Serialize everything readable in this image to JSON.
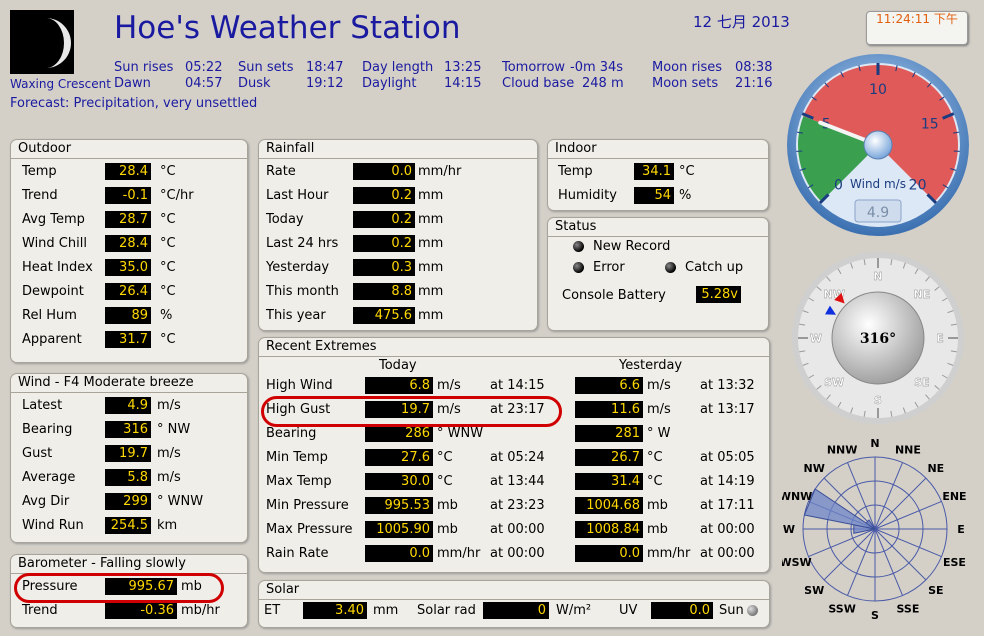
{
  "header": {
    "title": "Hoe's Weather Station",
    "date": "12 七月 2013",
    "time": "11:24:11 下午",
    "moon_phase": "Waxing Crescent",
    "forecast": "Forecast: Precipitation, very unsettled"
  },
  "sun": [
    {
      "label": "Sun rises",
      "value": "05:22"
    },
    {
      "label": "Sun sets",
      "value": "18:47"
    },
    {
      "label": "Day length",
      "value": "13:25"
    },
    {
      "label": "Tomorrow",
      "value": "-0m 34s"
    },
    {
      "label": "Moon rises",
      "value": "08:38"
    },
    {
      "label": "Dawn",
      "value": "04:57"
    },
    {
      "label": "Dusk",
      "value": "19:12"
    },
    {
      "label": "Daylight",
      "value": "14:15"
    },
    {
      "label": "Cloud base",
      "value": "248 m"
    },
    {
      "label": "Moon sets",
      "value": "21:16"
    }
  ],
  "outdoor": {
    "title": "Outdoor",
    "rows": [
      {
        "label": "Temp",
        "value": "28.4",
        "unit": "°C"
      },
      {
        "label": "Trend",
        "value": "-0.1",
        "unit": "°C/hr"
      },
      {
        "label": "Avg Temp",
        "value": "28.7",
        "unit": "°C"
      },
      {
        "label": "Wind Chill",
        "value": "28.4",
        "unit": "°C"
      },
      {
        "label": "Heat Index",
        "value": "35.0",
        "unit": "°C"
      },
      {
        "label": "Dewpoint",
        "value": "26.4",
        "unit": "°C"
      },
      {
        "label": "Rel Hum",
        "value": "89",
        "unit": "%"
      },
      {
        "label": "Apparent",
        "value": "31.7",
        "unit": "°C"
      }
    ]
  },
  "wind": {
    "title": "Wind - F4 Moderate breeze",
    "rows": [
      {
        "label": "Latest",
        "value": "4.9",
        "unit": "m/s"
      },
      {
        "label": "Bearing",
        "value": "316",
        "unit": "°  NW"
      },
      {
        "label": "Gust",
        "value": "19.7",
        "unit": "m/s"
      },
      {
        "label": "Average",
        "value": "5.8",
        "unit": "m/s"
      },
      {
        "label": "Avg Dir",
        "value": "299",
        "unit": "°  WNW"
      },
      {
        "label": "Wind Run",
        "value": "254.5",
        "unit": "km"
      }
    ]
  },
  "barometer": {
    "title": "Barometer - Falling slowly",
    "rows": [
      {
        "label": "Pressure",
        "value": "995.67",
        "unit": "mb"
      },
      {
        "label": "Trend",
        "value": "-0.36",
        "unit": "mb/hr"
      }
    ]
  },
  "rainfall": {
    "title": "Rainfall",
    "rows": [
      {
        "label": "Rate",
        "value": "0.0",
        "unit": "mm/hr"
      },
      {
        "label": "Last Hour",
        "value": "0.2",
        "unit": "mm"
      },
      {
        "label": "Today",
        "value": "0.2",
        "unit": "mm"
      },
      {
        "label": "Last 24 hrs",
        "value": "0.2",
        "unit": "mm"
      },
      {
        "label": "Yesterday",
        "value": "0.3",
        "unit": "mm"
      },
      {
        "label": "This month",
        "value": "8.8",
        "unit": "mm"
      },
      {
        "label": "This year",
        "value": "475.6",
        "unit": "mm"
      }
    ]
  },
  "indoor": {
    "title": "Indoor",
    "rows": [
      {
        "label": "Temp",
        "value": "34.1",
        "unit": "°C"
      },
      {
        "label": "Humidity",
        "value": "54",
        "unit": "%"
      }
    ]
  },
  "status": {
    "title": "Status",
    "new_record": "New Record",
    "error": "Error",
    "catch_up": "Catch up",
    "battery_label": "Console Battery",
    "battery_value": "5.28v"
  },
  "extremes": {
    "title": "Recent Extremes",
    "today": "Today",
    "yesterday": "Yesterday",
    "rows": [
      {
        "label": "High Wind",
        "t_val": "6.8",
        "t_unit": "m/s",
        "t_time": "at 14:15",
        "y_val": "6.6",
        "y_unit": "m/s",
        "y_time": "at 13:32"
      },
      {
        "label": "High Gust",
        "t_val": "19.7",
        "t_unit": "m/s",
        "t_time": "at 23:17",
        "y_val": "11.6",
        "y_unit": "m/s",
        "y_time": "at 13:17"
      },
      {
        "label": "Bearing",
        "t_val": "286",
        "t_unit": "°  WNW",
        "t_time": "",
        "y_val": "281",
        "y_unit": "°  W",
        "y_time": ""
      },
      {
        "label": "Min Temp",
        "t_val": "27.6",
        "t_unit": "°C",
        "t_time": "at 05:24",
        "y_val": "26.7",
        "y_unit": "°C",
        "y_time": "at 05:05"
      },
      {
        "label": "Max Temp",
        "t_val": "30.0",
        "t_unit": "°C",
        "t_time": "at 13:44",
        "y_val": "31.4",
        "y_unit": "°C",
        "y_time": "at 14:19"
      },
      {
        "label": "Min Pressure",
        "t_val": "995.53",
        "t_unit": "mb",
        "t_time": "at 23:23",
        "y_val": "1004.68",
        "y_unit": "mb",
        "y_time": "at 17:11"
      },
      {
        "label": "Max Pressure",
        "t_val": "1005.90",
        "t_unit": "mb",
        "t_time": "at 00:00",
        "y_val": "1008.84",
        "y_unit": "mb",
        "y_time": "at 00:00"
      },
      {
        "label": "Rain Rate",
        "t_val": "0.0",
        "t_unit": "mm/hr",
        "t_time": "at 00:00",
        "y_val": "0.0",
        "y_unit": "mm/hr",
        "y_time": "at 00:00"
      }
    ]
  },
  "solar": {
    "title": "Solar",
    "et_label": "ET",
    "et_value": "3.40",
    "et_unit": "mm",
    "rad_label": "Solar rad",
    "rad_value": "0",
    "rad_unit": "W/m²",
    "uv_label": "UV",
    "uv_value": "0.0",
    "sun_label": "Sun"
  },
  "gauge": {
    "ticks": [
      "0",
      "5",
      "10",
      "15",
      "20"
    ],
    "label": "Wind m/s",
    "reading": "4.9",
    "value": 4.9,
    "max": 20,
    "colors": {
      "green": "#3aa050",
      "red": "#e05a5a"
    }
  },
  "compass": {
    "bearing_text": "316°",
    "bearing": 316,
    "avg_bearing": 299,
    "directions": [
      "N",
      "NE",
      "E",
      "SE",
      "S",
      "SW",
      "W",
      "NW"
    ]
  },
  "rose": {
    "labels": [
      "N",
      "NNE",
      "NE",
      "ENE",
      "E",
      "ESE",
      "SE",
      "SSE",
      "S",
      "SSW",
      "SW",
      "WSW",
      "W",
      "WNW",
      "NW",
      "NNW"
    ],
    "petals": [
      0,
      0,
      0,
      0,
      0,
      0,
      0,
      0,
      0,
      0,
      0,
      0,
      0.3,
      1.0,
      0.15,
      0
    ]
  }
}
